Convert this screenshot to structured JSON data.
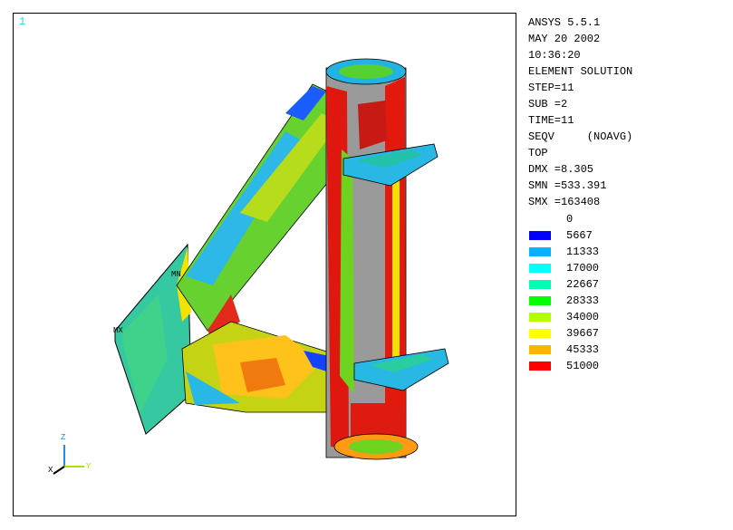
{
  "window_number": "1",
  "info": {
    "program": "ANSYS 5.5.1",
    "date": "MAY 20 2002",
    "time": "10:36:20",
    "solution": "ELEMENT SOLUTION",
    "step": "STEP=11",
    "sub": "SUB =2",
    "time_val": "TIME=11",
    "item": "SEQV     (NOAVG)",
    "layer": "TOP",
    "dmx": "DMX =8.305",
    "smn": "SMN =533.391",
    "smx": "SMX =163408"
  },
  "legend": {
    "levels": [
      "0",
      "5667",
      "11333",
      "17000",
      "22667",
      "28333",
      "34000",
      "39667",
      "45333",
      "51000"
    ],
    "colors": [
      "#0000ff",
      "#00b4ff",
      "#00ffff",
      "#00ffb4",
      "#00ff00",
      "#b4ff00",
      "#ffff00",
      "#ffb400",
      "#ff0000"
    ]
  },
  "model_labels": {
    "mn": "MN",
    "mx": "MX"
  },
  "triad": {
    "x": "X",
    "y": "Y",
    "z": "Z"
  }
}
